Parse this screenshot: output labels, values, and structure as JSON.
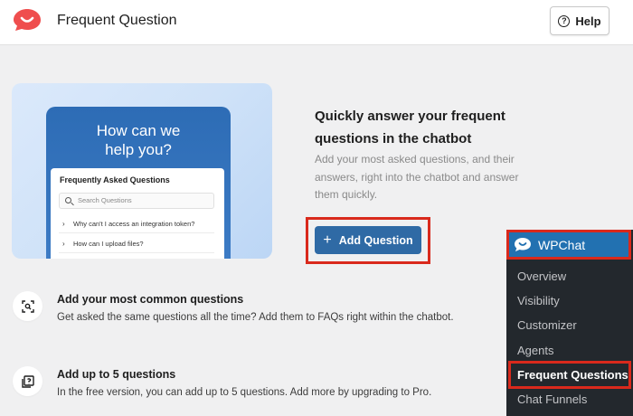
{
  "header": {
    "title": "Frequent Question",
    "help_label": "Help",
    "brand_color": "#ef4e4e"
  },
  "illustration": {
    "headline": "How can we help you?",
    "panel_title": "Frequently Asked Questions",
    "search_placeholder": "Search Questions",
    "items": [
      "Why can't I access an integration token?",
      "How can I upload files?"
    ]
  },
  "intro": {
    "title": "Quickly answer your frequent questions in the chatbot",
    "description": "Add your most asked questions, and their answers, right into the chatbot and answer them quickly.",
    "add_button_label": "Add Question"
  },
  "features": [
    {
      "icon": "scan-focus-icon",
      "title": "Add your most common questions",
      "description": "Get asked the same questions all the time? Add them to FAQs right within the chatbot."
    },
    {
      "icon": "question-square-icon",
      "title": "Add up to 5 questions",
      "description": "In the free version, you can add up to 5 questions. Add more by upgrading to Pro."
    }
  ],
  "wp_menu": {
    "brand": "WPChat",
    "items": [
      "Overview",
      "Visibility",
      "Customizer",
      "Agents",
      "Frequent Questions",
      "Chat Funnels"
    ],
    "active_item": "Frequent Questions"
  },
  "colors": {
    "accent_blue": "#2f6aa5",
    "highlight_red": "#d9291c",
    "wp_sidebar": "#23282d",
    "wp_active": "#2271b1"
  }
}
